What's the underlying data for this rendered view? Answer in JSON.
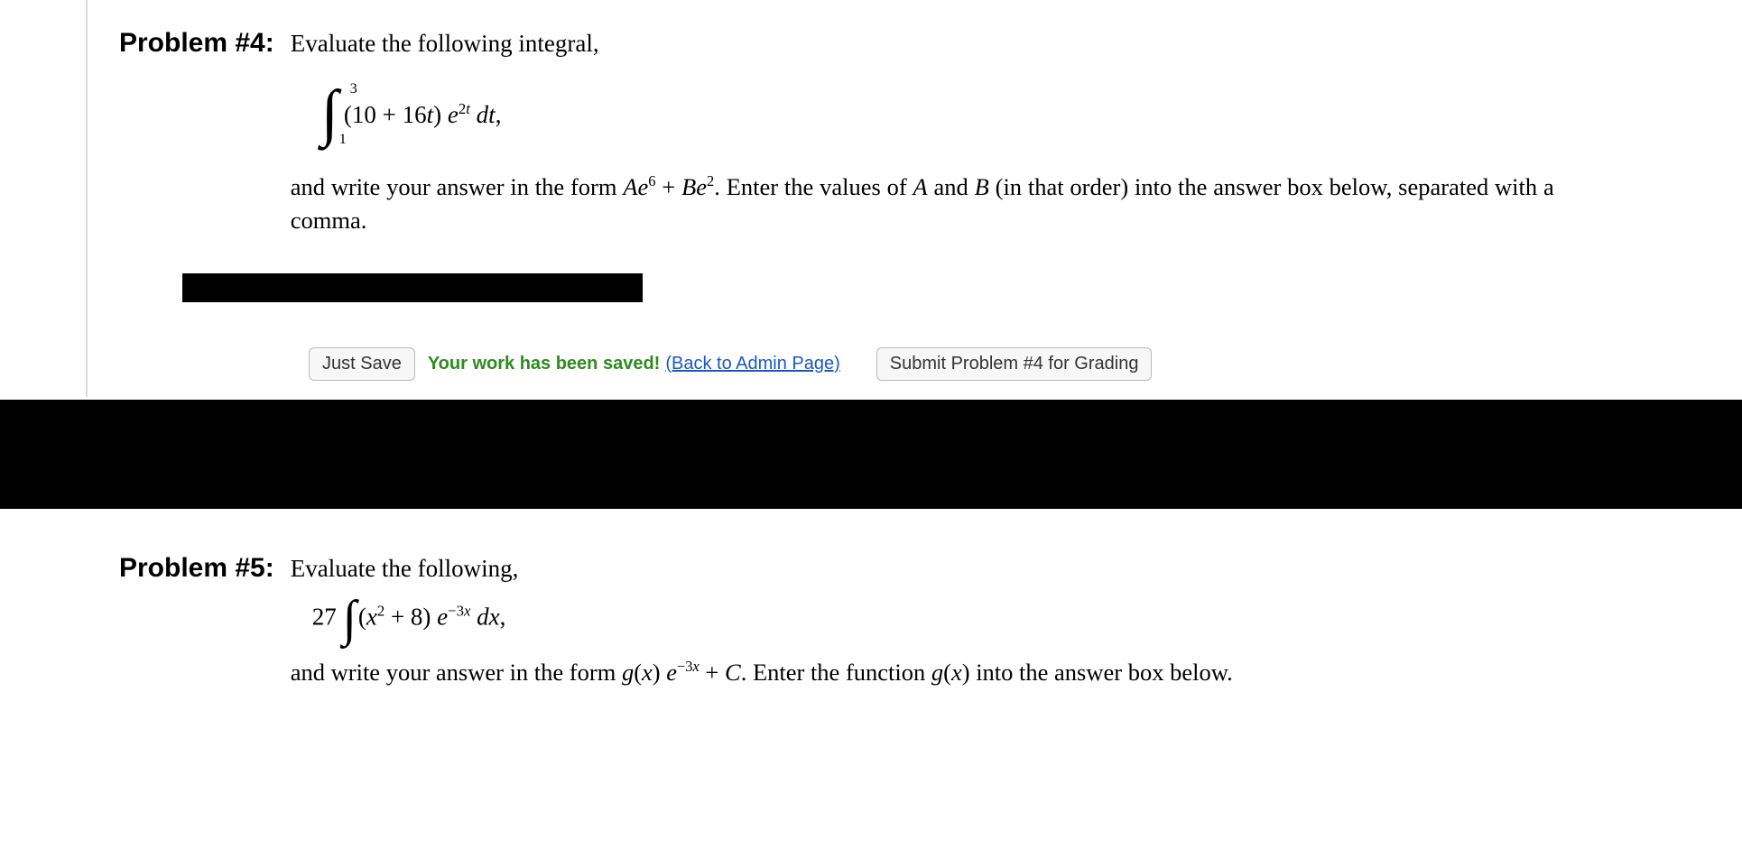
{
  "problem4": {
    "label": "Problem #4:",
    "prompt": "Evaluate the following integral,",
    "integral": {
      "lower_limit": "1",
      "upper_limit": "3",
      "open": "(10 + 16",
      "var_t": "t",
      "close_paren": ") ",
      "e": "e",
      "exp_num": "2",
      "exp_var": "t",
      "dt_d": " d",
      "dt_t": "t",
      "comma": ","
    },
    "explanation": {
      "pre": "and write your answer in the form ",
      "Ae": "Ae",
      "six": "6",
      "plus": " + ",
      "Be": "Be",
      "two": "2",
      "mid": ". Enter the values of ",
      "A": "A",
      "and": " and ",
      "B": "B",
      "post": " (in that order) into the answer box below, separated with a comma."
    },
    "buttons": {
      "just_save": "Just Save",
      "saved_msg": "Your work has been saved!",
      "admin_link": "(Back to Admin Page)",
      "submit": "Submit Problem #4 for Grading"
    }
  },
  "problem5": {
    "label": "Problem #5:",
    "prompt": "Evaluate the following,",
    "integral": {
      "coef": "27 ",
      "open": "(",
      "x": "x",
      "sq": "2",
      "plus8": " + 8) ",
      "e": "e",
      "neg3": "−3",
      "xexp": "x",
      "dx_d": " d",
      "dx_x": "x",
      "comma": ","
    },
    "explanation": {
      "pre": "and write your answer in the form ",
      "g": "g",
      "paren_x": "(",
      "x1": "x",
      "close_paren": ") ",
      "e": "e",
      "neg3": "−3",
      "xexp": "x",
      "plusC": " + ",
      "C": "C",
      "mid": ". Enter the function ",
      "g2": "g",
      "paren_x2": "(",
      "x2": "x",
      "close_paren2": ")",
      "post": " into the answer box below."
    }
  }
}
